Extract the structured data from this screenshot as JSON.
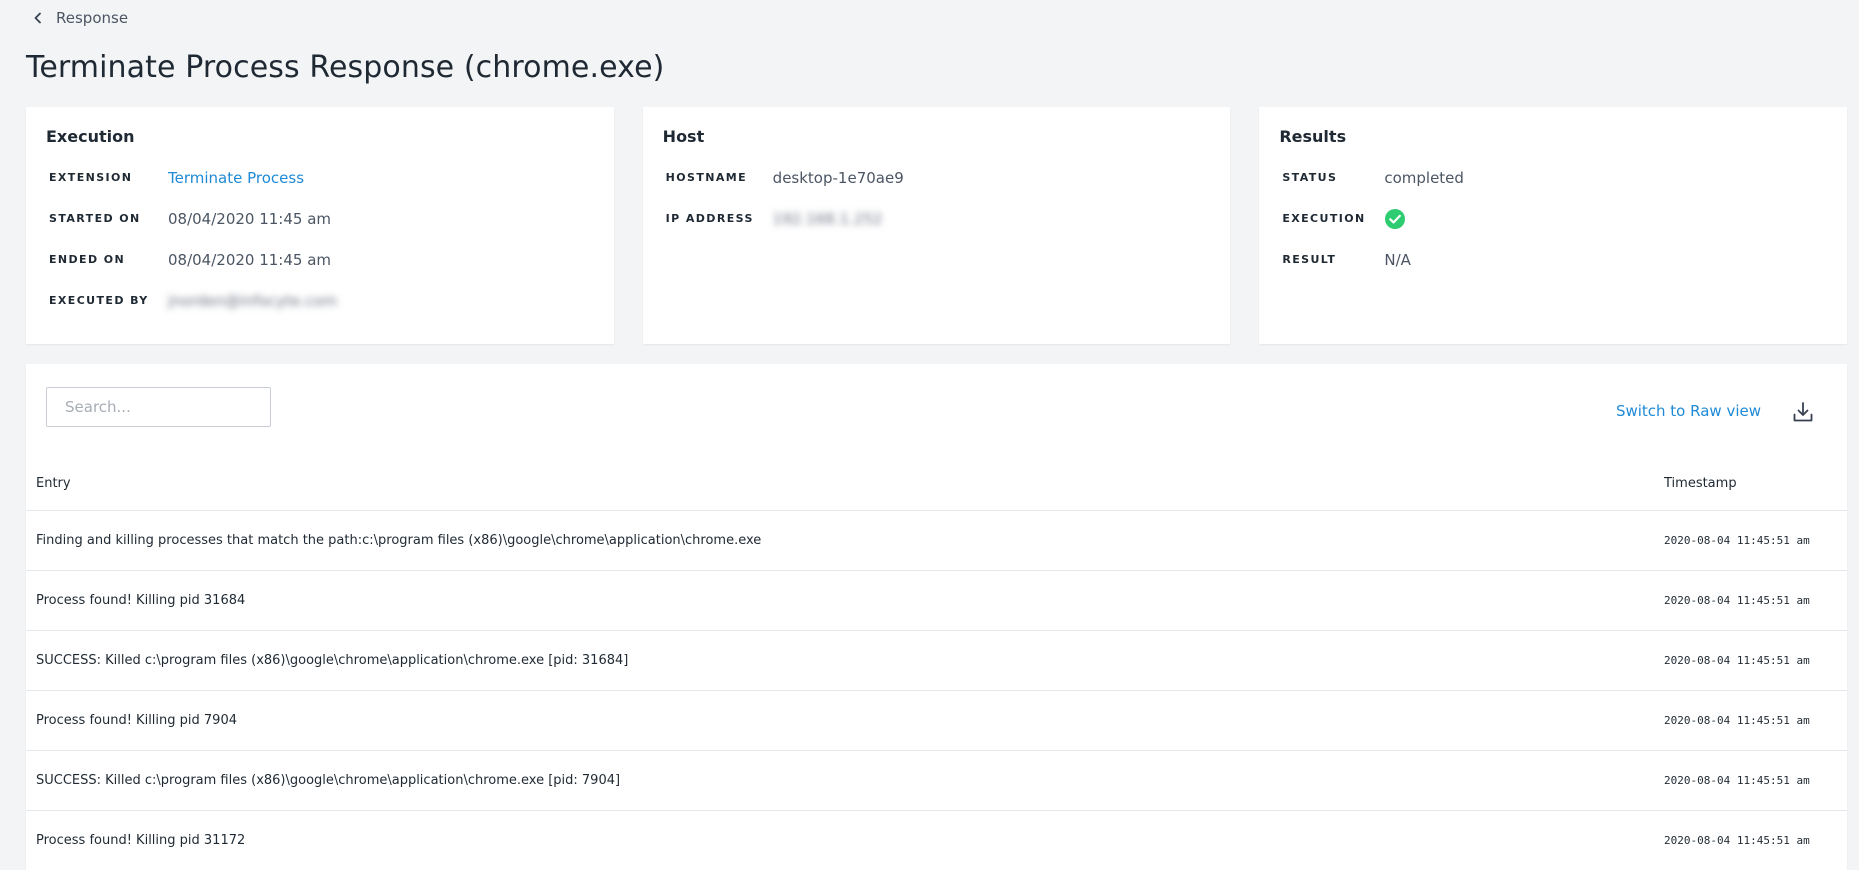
{
  "breadcrumb": {
    "label": "Response"
  },
  "page": {
    "title": "Terminate Process Response (chrome.exe)"
  },
  "execution": {
    "title": "Execution",
    "fields": [
      {
        "key": "EXTENSION",
        "value": "Terminate Process"
      },
      {
        "key": "STARTED ON",
        "value": "08/04/2020 11:45 am"
      },
      {
        "key": "ENDED ON",
        "value": "08/04/2020 11:45 am"
      },
      {
        "key": "EXECUTED BY",
        "value": "jnorden@infocyte.com"
      }
    ]
  },
  "host": {
    "title": "Host",
    "fields": [
      {
        "key": "HOSTNAME",
        "value": "desktop-1e70ae9"
      },
      {
        "key": "IP ADDRESS",
        "value": "192.168.1.252"
      }
    ]
  },
  "results": {
    "title": "Results",
    "fields": [
      {
        "key": "STATUS",
        "value": "completed"
      },
      {
        "key": "EXECUTION",
        "icon": "check-circle-icon",
        "color": "#2ecc71"
      },
      {
        "key": "RESULT",
        "value": "N/A"
      }
    ]
  },
  "toolbar": {
    "search_placeholder": "Search...",
    "raw_view_label": "Switch to Raw view",
    "download_icon": "download-icon"
  },
  "table": {
    "columns": {
      "entry": "Entry",
      "timestamp": "Timestamp"
    },
    "rows": [
      {
        "entry": "Finding and killing processes that match the path:c:\\program files (x86)\\google\\chrome\\application\\chrome.exe",
        "timestamp": "2020-08-04 11:45:51 am"
      },
      {
        "entry": "Process found! Killing pid 31684",
        "timestamp": "2020-08-04 11:45:51 am"
      },
      {
        "entry": "SUCCESS: Killed c:\\program files (x86)\\google\\chrome\\application\\chrome.exe [pid: 31684]",
        "timestamp": "2020-08-04 11:45:51 am"
      },
      {
        "entry": "Process found! Killing pid 7904",
        "timestamp": "2020-08-04 11:45:51 am"
      },
      {
        "entry": "SUCCESS: Killed c:\\program files (x86)\\google\\chrome\\application\\chrome.exe [pid: 7904]",
        "timestamp": "2020-08-04 11:45:51 am"
      },
      {
        "entry": "Process found! Killing pid 31172",
        "timestamp": "2020-08-04 11:45:51 am"
      }
    ]
  },
  "colors": {
    "accent": "#1f8ad6",
    "success": "#2ecc71",
    "background": "#f3f4f6"
  }
}
